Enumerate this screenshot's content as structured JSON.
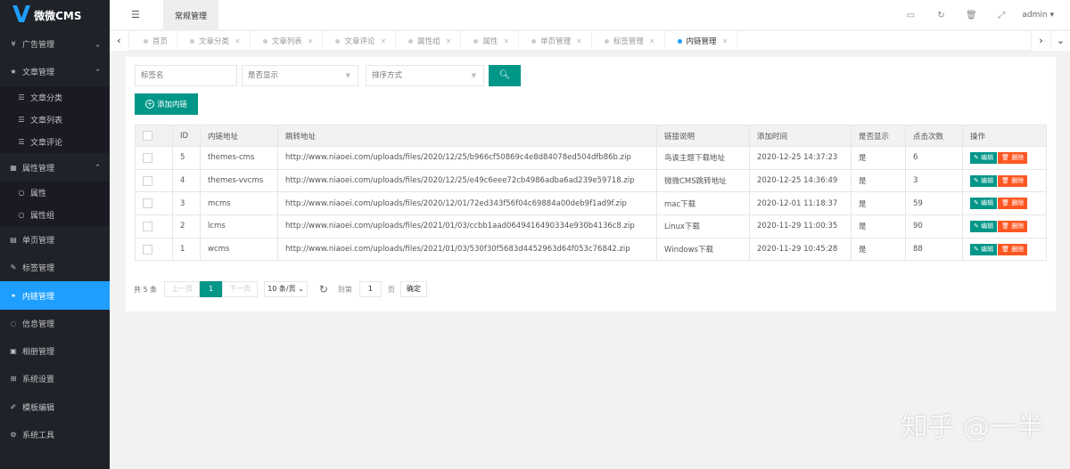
{
  "app": {
    "logo_letter": "V",
    "logo_text": "微微CMS"
  },
  "header": {
    "tab": "常规管理",
    "user": "admin",
    "icons": [
      "monitor-icon",
      "refresh-icon",
      "trash-icon",
      "fullscreen-icon"
    ]
  },
  "sidebar": {
    "items": [
      {
        "label": "广告管理",
        "icon": "¥"
      },
      {
        "label": "文章管理",
        "icon": "★"
      },
      {
        "label": "文章分类"
      },
      {
        "label": "文章列表"
      },
      {
        "label": "文章评论"
      },
      {
        "label": "属性管理",
        "icon": "▦"
      },
      {
        "label": "属性"
      },
      {
        "label": "属性组"
      },
      {
        "label": "单页管理",
        "icon": "▤"
      },
      {
        "label": "标签管理",
        "icon": "✎"
      },
      {
        "label": "内链管理",
        "icon": "⚭"
      },
      {
        "label": "信息管理",
        "icon": "◌"
      },
      {
        "label": "相册管理",
        "icon": "▣"
      },
      {
        "label": "系统设置",
        "icon": "⊞"
      },
      {
        "label": "模板编辑",
        "icon": "✐"
      },
      {
        "label": "系统工具",
        "icon": "⚙"
      }
    ]
  },
  "tabs": [
    "首页",
    "文章分类",
    "文章列表",
    "文章评论",
    "属性组",
    "属性",
    "单页管理",
    "标签管理",
    "内链管理"
  ],
  "filters": {
    "tag_placeholder": "标签名",
    "show_placeholder": "是否显示",
    "sort_placeholder": "排序方式"
  },
  "add_button": "添加内链",
  "table": {
    "headers": [
      "ID",
      "内链地址",
      "跳转地址",
      "链接说明",
      "添加时间",
      "是否显示",
      "点击次数",
      "操作"
    ],
    "rows": [
      [
        "5",
        "themes-cms",
        "http://www.niaoei.com/uploads/files/2020/12/25/b966cf50869c4e8d84078ed504dfb86b.zip",
        "鸟诶主题下载地址",
        "2020-12-25 14:37:23",
        "是",
        "6"
      ],
      [
        "4",
        "themes-vvcms",
        "http://www.niaoei.com/uploads/files/2020/12/25/e49c6eee72cb4986adba6ad239e59718.zip",
        "微微CMS跳转地址",
        "2020-12-25 14:36:49",
        "是",
        "3"
      ],
      [
        "3",
        "mcms",
        "http://www.niaoei.com/uploads/files/2020/12/01/72ed343f56f04c69884a00deb9f1ad9f.zip",
        "mac下载",
        "2020-12-01 11:18:37",
        "是",
        "59"
      ],
      [
        "2",
        "lcms",
        "http://www.niaoei.com/uploads/files/2021/01/03/ccbb1aad0649416490334e930b4136c8.zip",
        "Linux下载",
        "2020-11-29 11:00:35",
        "是",
        "90"
      ],
      [
        "1",
        "wcms",
        "http://www.niaoei.com/uploads/files/2021/01/03/530f30f5683d4452963d64f053c76842.zip",
        "Windows下载",
        "2020-11-29 10:45:28",
        "是",
        "88"
      ]
    ],
    "edit_label": "编辑",
    "delete_label": "删除"
  },
  "pager": {
    "total": "共 5 条",
    "prev": "上一页",
    "current": "1",
    "next": "下一页",
    "page_size": "10 条/页",
    "goto": "到第",
    "goto_value": "1",
    "page_unit": "页",
    "ok": "确定"
  },
  "watermark": "知乎 @一半",
  "colors": {
    "accent": "#009688",
    "active_menu": "#1e9fff",
    "danger": "#ff5722",
    "sidebar_bg": "#20222a"
  }
}
